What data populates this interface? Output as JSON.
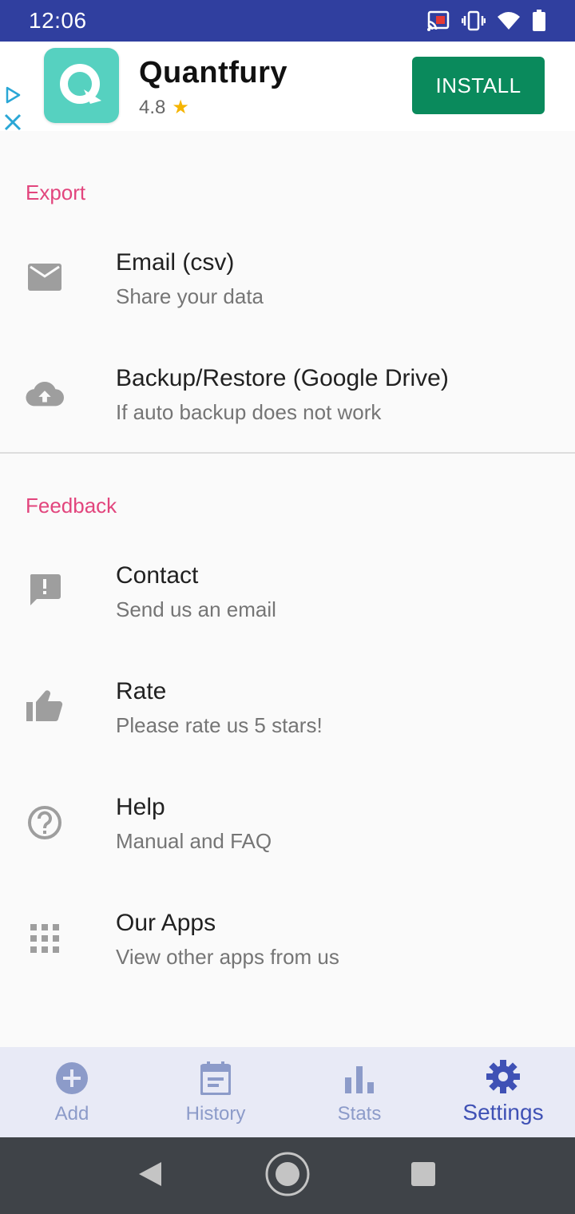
{
  "status_bar": {
    "time": "12:06"
  },
  "ad": {
    "title": "Quantfury",
    "rating": "4.8",
    "install_label": "INSTALL"
  },
  "sections": {
    "export": {
      "header": "Export",
      "items": [
        {
          "title": "Email (csv)",
          "subtitle": "Share your data",
          "icon": "email-icon"
        },
        {
          "title": "Backup/Restore (Google Drive)",
          "subtitle": "If auto backup does not work",
          "icon": "cloud-upload-icon"
        }
      ]
    },
    "feedback": {
      "header": "Feedback",
      "items": [
        {
          "title": "Contact",
          "subtitle": "Send us an email",
          "icon": "feedback-icon"
        },
        {
          "title": "Rate",
          "subtitle": "Please rate us 5 stars!",
          "icon": "thumb-up-icon"
        },
        {
          "title": "Help",
          "subtitle": "Manual and FAQ",
          "icon": "help-icon"
        },
        {
          "title": "Our Apps",
          "subtitle": "View other apps from us",
          "icon": "apps-grid-icon"
        }
      ]
    }
  },
  "bottom_nav": {
    "items": [
      {
        "label": "Add",
        "icon": "add-circle-icon",
        "active": false
      },
      {
        "label": "History",
        "icon": "calendar-icon",
        "active": false
      },
      {
        "label": "Stats",
        "icon": "bar-chart-icon",
        "active": false
      },
      {
        "label": "Settings",
        "icon": "gear-icon",
        "active": true
      }
    ]
  },
  "colors": {
    "status_bar": "#303f9f",
    "accent": "#e2457d",
    "nav_active": "#3f51b5",
    "nav_inactive": "#8c9bc9",
    "install_button": "#0a8a5c"
  }
}
